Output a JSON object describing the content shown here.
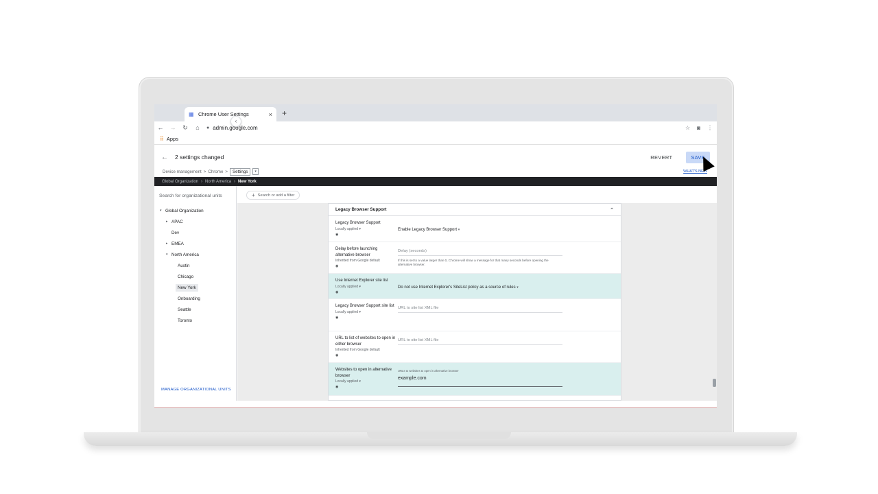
{
  "browser": {
    "tab_title": "Chrome User Settings",
    "tab_close": "×",
    "new_tab": "+",
    "url": "admin.google.com",
    "bookmark": "Apps",
    "icons": [
      "back-icon",
      "forward-icon",
      "reload-icon",
      "home-icon",
      "lock-icon",
      "star-icon",
      "camera-icon",
      "menu-icon"
    ]
  },
  "header": {
    "back": "←",
    "changes_message": "2 settings changed",
    "revert_label": "REVERT",
    "save_label": "SAVE",
    "whats_new": "WHAT'S NEW"
  },
  "breadcrumb": {
    "items": [
      "Device management",
      "Chrome",
      "Settings"
    ],
    "sep": ">"
  },
  "org_path": {
    "items": [
      "Global Organization",
      "North America",
      "New York"
    ]
  },
  "sidebar": {
    "search_placeholder": "Search for organizational units",
    "tree": [
      {
        "label": "Global Organization",
        "level": 0,
        "arrow": "▾"
      },
      {
        "label": "APAC",
        "level": 1,
        "arrow": "▸"
      },
      {
        "label": "Dev",
        "level": 1,
        "arrow": ""
      },
      {
        "label": "EMEA",
        "level": 1,
        "arrow": "▸"
      },
      {
        "label": "North America",
        "level": 1,
        "arrow": "▾"
      },
      {
        "label": "Austin",
        "level": 2,
        "arrow": ""
      },
      {
        "label": "Chicago",
        "level": 2,
        "arrow": ""
      },
      {
        "label": "New York",
        "level": 2,
        "arrow": "",
        "selected": true
      },
      {
        "label": "Onboarding",
        "level": 2,
        "arrow": ""
      },
      {
        "label": "Seattle",
        "level": 2,
        "arrow": ""
      },
      {
        "label": "Toronto",
        "level": 2,
        "arrow": ""
      }
    ],
    "manage_label": "MANAGE ORGANIZATIONAL UNITS"
  },
  "filter": {
    "label": "Search or add a filter"
  },
  "section": {
    "title": "Legacy Browser Support",
    "rows": [
      {
        "name": "Legacy Browser Support",
        "source": "Locally applied",
        "value": "Enable Legacy Browser Support",
        "kind": "select",
        "highlight": false
      },
      {
        "name": "Delay before launching alternative browser",
        "source": "Inherited from Google default",
        "placeholder": "Delay (seconds)",
        "hint": "If this is set to a value larger than 0, Chrome will show a message for that many seconds before opening the alternative browser.",
        "kind": "input",
        "highlight": false
      },
      {
        "name": "Use Internet Explorer site list",
        "source": "Locally applied",
        "value": "Do not use Internet Explorer's SiteList policy as a source of rules",
        "kind": "select",
        "highlight": true
      },
      {
        "name": "Legacy Browser Support site list",
        "source": "Locally applied",
        "placeholder": "URL to site list XML file",
        "kind": "input",
        "highlight": false
      },
      {
        "name": "URL to list of websites to open in either browser",
        "source": "Inherited from Google default",
        "placeholder": "URL to site list XML file",
        "kind": "input",
        "highlight": false
      },
      {
        "name": "Websites to open in alternative browser",
        "source": "Locally applied",
        "field_label": "URLs to websites to open in alternative browser",
        "value": "example.com",
        "kind": "textarea",
        "highlight": true
      }
    ]
  }
}
